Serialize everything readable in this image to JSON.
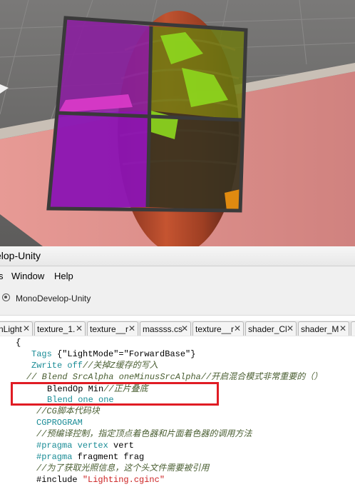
{
  "window": {
    "title": "elop-Unity"
  },
  "menu": {
    "items": [
      "s",
      "Window",
      "Help"
    ]
  },
  "toolbar": {
    "solution_label": "MonoDevelop-Unity"
  },
  "tabs": [
    {
      "label": "nLight",
      "close": "✕"
    },
    {
      "label": "texture_1.",
      "close": "✕"
    },
    {
      "label": "texture__r",
      "close": "✕"
    },
    {
      "label": "massss.cs",
      "close": "✕"
    },
    {
      "label": "texture__r",
      "close": "✕"
    },
    {
      "label": "shader_Cl",
      "close": "✕"
    },
    {
      "label": "shader_M",
      "close": "✕"
    }
  ],
  "code": {
    "l1": "{",
    "l2_kw": "Tags",
    "l2_rest": " {\"LightMode\"=\"ForwardBase\"}",
    "l3_kw": "Zwrite off",
    "l3_cm": "//关掉Z缓存的写入",
    "l4_cm": "// Blend SrcAlpha oneMinusSrcAlpha//开启混合模式非常重要的（）",
    "l5_pl": "BlendOp Min",
    "l5_cm": "//正片叠底",
    "l6_kw": "Blend one one",
    "l7_cm": "//CG脚本代码块",
    "l8_kw": "CGPROGRAM",
    "l9_cm": "//预编译控制，指定顶点着色器和片面着色器的调用方法",
    "l10_pp": "#pragma",
    "l10_kw": " vertex",
    "l10_pl": " vert",
    "l11_pp": "#pragma",
    "l11_pl": " fragment frag",
    "l12_cm": "//为了获取光照信息，这个头文件需要被引用",
    "l13_pl": "#include ",
    "l13_st": "\"Lighting.cginc\""
  },
  "colors": {
    "highlight_box": "#e01c24",
    "keyword": "#1a8c96",
    "comment": "#4b5f33",
    "string": "#c22"
  }
}
